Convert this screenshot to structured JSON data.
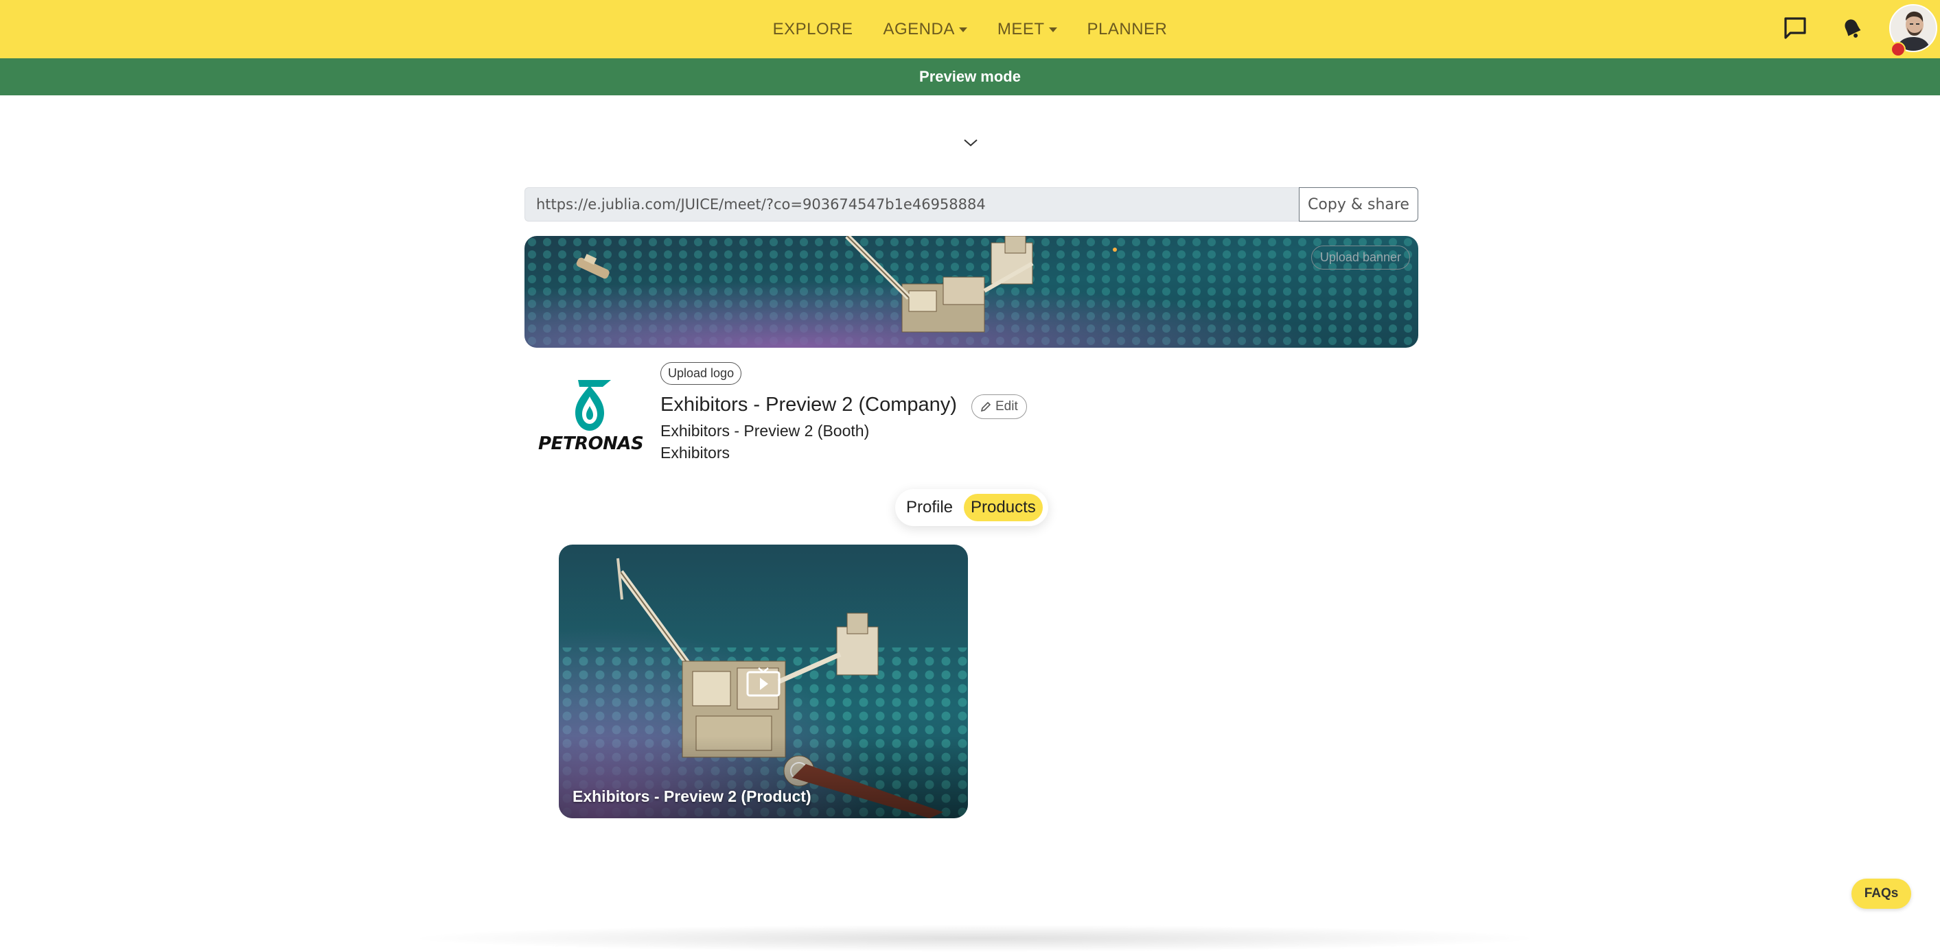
{
  "nav": {
    "items": [
      {
        "label": "EXPLORE",
        "dropdown": false
      },
      {
        "label": "AGENDA",
        "dropdown": true
      },
      {
        "label": "MEET",
        "dropdown": true
      },
      {
        "label": "PLANNER",
        "dropdown": false
      }
    ],
    "icons": [
      "chat-icon",
      "bell-icon",
      "avatar"
    ]
  },
  "preview": {
    "label": "Preview mode"
  },
  "share": {
    "url": "https://e.jublia.com/JUICE/meet/?co=903674547b1e46958884",
    "button_label": "Copy & share"
  },
  "banner": {
    "upload_label": "Upload banner"
  },
  "company": {
    "logo_text": "PETRONAS",
    "upload_logo_label": "Upload logo",
    "name": "Exhibitors - Preview 2 (Company)",
    "edit_label": "Edit",
    "booth": "Exhibitors - Preview 2 (Booth)",
    "category": "Exhibitors"
  },
  "tabs": [
    {
      "label": "Profile",
      "active": false
    },
    {
      "label": "Products",
      "active": true
    }
  ],
  "products": [
    {
      "title": "Exhibitors - Preview 2 (Product)",
      "icon": "play-icon"
    }
  ],
  "faqs": {
    "label": "FAQs"
  },
  "colors": {
    "brand_yellow": "#fbe04a",
    "preview_green": "#3d8452",
    "petronas_teal": "#00a19c"
  }
}
